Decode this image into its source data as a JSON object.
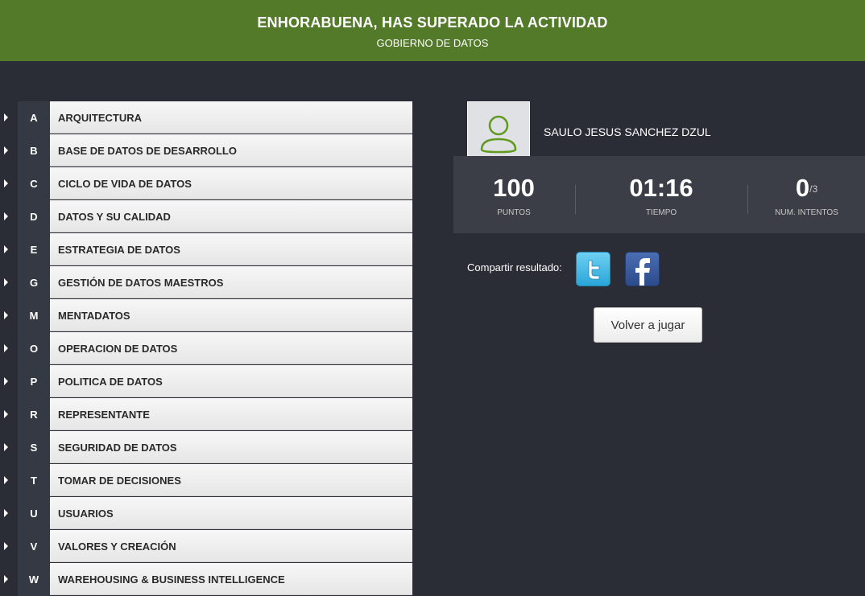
{
  "header": {
    "title": "ENHORABUENA, HAS SUPERADO LA ACTIVIDAD",
    "subtitle": "GOBIERNO DE DATOS"
  },
  "categories": [
    {
      "letter": "A",
      "label": "ARQUITECTURA"
    },
    {
      "letter": "B",
      "label": "BASE DE DATOS DE DESARROLLO"
    },
    {
      "letter": "C",
      "label": "CICLO DE VIDA DE DATOS"
    },
    {
      "letter": "D",
      "label": "DATOS Y SU CALIDAD"
    },
    {
      "letter": "E",
      "label": "ESTRATEGIA DE DATOS"
    },
    {
      "letter": "G",
      "label": "GESTIÓN DE DATOS MAESTROS"
    },
    {
      "letter": "M",
      "label": "MENTADATOS"
    },
    {
      "letter": "O",
      "label": "OPERACION DE DATOS"
    },
    {
      "letter": "P",
      "label": "POLITICA DE DATOS"
    },
    {
      "letter": "R",
      "label": "REPRESENTANTE"
    },
    {
      "letter": "S",
      "label": "SEGURIDAD DE DATOS"
    },
    {
      "letter": "T",
      "label": "TOMAR DE DECISIONES"
    },
    {
      "letter": "U",
      "label": "USUARIOS"
    },
    {
      "letter": "V",
      "label": "VALORES Y CREACIÓN"
    },
    {
      "letter": "W",
      "label": "WAREHOUSING & BUSINESS INTELLIGENCE"
    }
  ],
  "profile": {
    "name": "SAULO JESUS SANCHEZ DZUL",
    "avatar_icon": "user-icon"
  },
  "stats": {
    "points_value": "100",
    "points_label": "PUNTOS",
    "time_value": "01:16",
    "time_label": "TIEMPO",
    "attempts_value": "0",
    "attempts_max": "/3",
    "attempts_label": "NUM. INTENTOS"
  },
  "share": {
    "label": "Compartir resultado:",
    "twitter_icon": "twitter-icon",
    "facebook_icon": "facebook-icon"
  },
  "replay_label": "Volver a jugar",
  "colors": {
    "header_green": "#527a29",
    "background": "#2a2d35",
    "avatar_stroke": "#5f9a1f"
  }
}
